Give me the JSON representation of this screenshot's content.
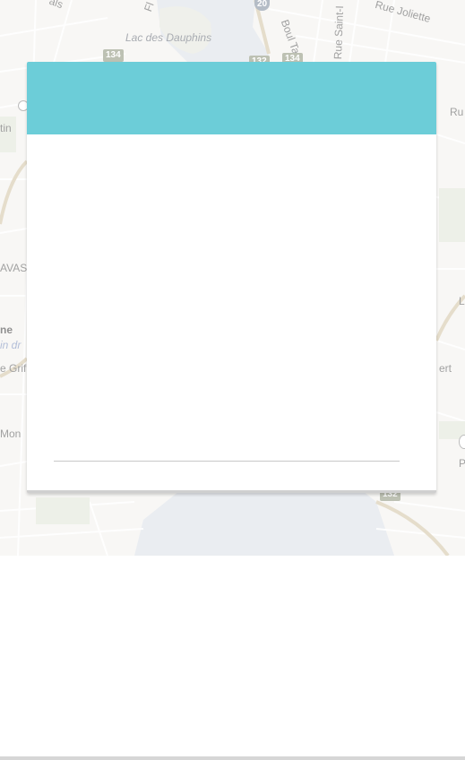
{
  "map": {
    "labels": {
      "lac_des_dauphins": "Lac des Dauphins",
      "rue_joliette": "Rue Joliette",
      "boul_taschereau": "Boul Taschereau",
      "rue_saint": "Rue Saint-I",
      "rue_right": "Ru",
      "tin": "tin",
      "vas": "AVAS",
      "ne": "ne",
      "in_dr": "in dr",
      "e_grif": "e Grif",
      "mon": "Mon",
      "ert": "ert",
      "l_right": "L",
      "p_right": "P",
      "als": "als",
      "fl": "Fl"
    },
    "shields": {
      "s134a": "134",
      "s20": "20",
      "s132": "132",
      "s134b": "134",
      "s132b": "132"
    }
  },
  "modal": {
    "title": ""
  },
  "colors": {
    "header": "#6ccdd8",
    "map_bg": "#f4f3f0",
    "water": "#dfe3ea"
  }
}
